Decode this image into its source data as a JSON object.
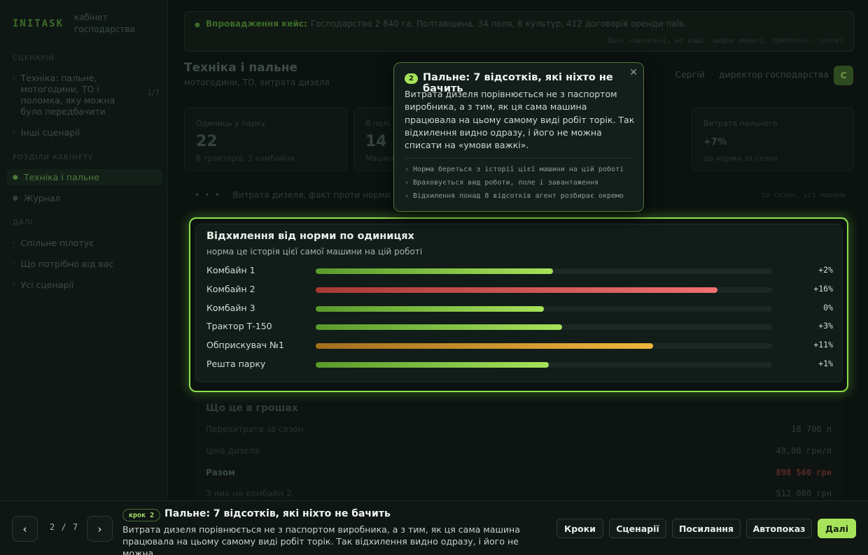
{
  "sidebar": {
    "logo": "INITASK",
    "logo_sub": "кабінет господарства",
    "section_scenario": "СЦЕНАРІЙ",
    "scenario_item": "Техніка: пальне, мотогодини, ТО і поломка, яку можна було передбачити",
    "scenario_count": "1/7",
    "other_scenarios": "Інші сценарії",
    "section_sections": "РОЗДІЛИ КАБІНЕТУ",
    "nav_active": "Техніка і пальне",
    "nav_journal": "Журнал",
    "section_more": "ДАЛІ",
    "more_items": [
      "Спільне пілотує",
      "Що потрібно від вас",
      "Усі сценарії"
    ]
  },
  "banner": {
    "label": "Впровадження кейс:",
    "text": "Господарство 2 840 га, Полтавщина, 34 поля, 6 культур, 412 договорів оренди паїв.",
    "sub": "Дані навчальні, не ваші; цифри умовні, приблизні, типові"
  },
  "page": {
    "title": "Техніка і пальне",
    "subtitle": "мотогодини, ТО, витрата дизеля",
    "user_name": "Сергій",
    "user_role": "директор господарства",
    "avatar": "С"
  },
  "stats": [
    {
      "label": "Одиниць у парку",
      "value": "22",
      "note": "6 тракторів, 3 комбайни"
    },
    {
      "label": "В полі",
      "value": "14",
      "note": "Машин"
    },
    {
      "label": "Витрата пального",
      "value": "+7%",
      "note": "до норми за сезон"
    }
  ],
  "crumb": "Витрата дизеля, факт проти норми",
  "crumb_right": "за сезон, усі машини",
  "card": {
    "title": "Відхилення від норми по одиницях",
    "subtitle": "норма це історія цієї самої машини на цій роботі"
  },
  "chart_data": {
    "type": "bar",
    "categories": [
      "Комбайн 1",
      "Комбайн 2",
      "Комбайн 3",
      "Трактор Т-150",
      "Обприскувач №1",
      "Решта парку"
    ],
    "series": [
      {
        "values": [
          2,
          16,
          0,
          3,
          11,
          1
        ]
      }
    ],
    "value_labels": [
      "+2%",
      "+16%",
      "0%",
      "+3%",
      "+11%",
      "+1%"
    ],
    "fill_fraction": [
      0.52,
      0.88,
      0.5,
      0.54,
      0.74,
      0.51
    ],
    "colors": [
      "green",
      "red",
      "green",
      "green",
      "amber",
      "green"
    ]
  },
  "colors": {
    "green_from": "#5a9a2c",
    "green_to": "#a6e35a",
    "red_from": "#a83a32",
    "red_to": "#f07070",
    "amber_from": "#a26f1e",
    "amber_to": "#f0b63c"
  },
  "money": {
    "title": "Що це в грошах",
    "rows": [
      {
        "label": "Перевитрата за сезон",
        "value": "18 700 л"
      },
      {
        "label": "Ціна дизеля",
        "value": "48,00 грн/л"
      },
      {
        "label": "Разом",
        "value": "898 560 грн"
      },
      {
        "label": "З них на комбайн 2",
        "value": "512 000 грн"
      }
    ]
  },
  "tooltip": {
    "step": "2",
    "title": "Пальне: 7 відсотків, які ніхто не бачить",
    "body": "Витрата дизеля порівнюється не з паспортом виробника, а з тим, як ця сама машина працювала на цьому самому виді робіт торік. Так відхилення видно одразу, і його не можна списати на «умови важкі».",
    "points": [
      "Норма береться з історії цієї машини на цій роботі",
      "Враховується вид роботи, поле і завантаження",
      "Відхилення понад 8 відсотків агент розбирає окремо"
    ]
  },
  "tour": {
    "counter": "2 / 7",
    "step_pill": "крок 2",
    "title": "Пальне: 7 відсотків, які ніхто не бачить",
    "desc": "Витрата дизеля порівнюється не з паспортом виробника, а з тим, як ця сама машина працювала на цьому самому виді робіт торік. Так відхилення видно одразу, і його не можна…",
    "prev_icon": "‹",
    "next_icon": "›",
    "buttons": {
      "steps": "Кроки",
      "scenarios": "Сценарії",
      "links": "Посилання",
      "autoplay": "Автопоказ",
      "next": "Далі"
    }
  }
}
